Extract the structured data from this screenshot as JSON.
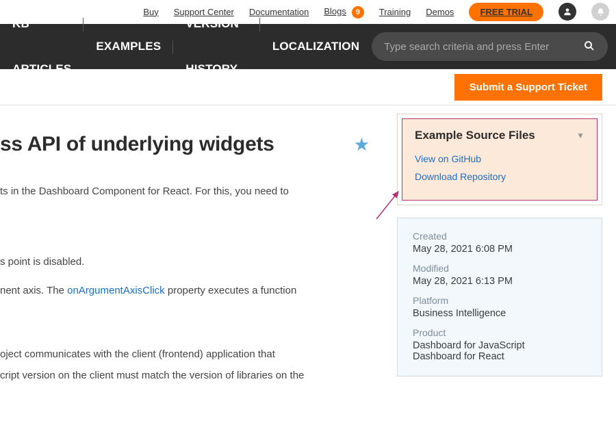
{
  "topnav": {
    "buy": "Buy",
    "support": "Support Center",
    "docs": "Documentation",
    "blogs": "Blogs",
    "blogs_count": "9",
    "training": "Training",
    "demos": "Demos",
    "free_trial": "FREE TRIAL"
  },
  "mainnav": {
    "kb": "KB ARTICLES",
    "examples": "EXAMPLES",
    "version": "VERSION HISTORY",
    "localization": "LOCALIZATION",
    "search_placeholder": "Type search criteria and press Enter"
  },
  "ticket_button": "Submit a Support Ticket",
  "article": {
    "title": "ss API of underlying widgets",
    "p1": "ts in the Dashboard Component for React. For this, you need to",
    "p2": "s point is disabled.",
    "p3_a": "nent axis. The ",
    "p3_link": "onArgumentAxisClick",
    "p3_b": " property executes a function",
    "p4": "oject communicates with the client (frontend) application that",
    "p5": "cript version on the client must match the version of libraries on the"
  },
  "sidebar": {
    "source": {
      "title": "Example Source Files",
      "github": "View on GitHub",
      "download": "Download Repository"
    },
    "meta": {
      "created_label": "Created",
      "created_value": "May 28, 2021 6:08 PM",
      "modified_label": "Modified",
      "modified_value": "May 28, 2021 6:13 PM",
      "platform_label": "Platform",
      "platform_value": "Business Intelligence",
      "product_label": "Product",
      "product_value1": "Dashboard for JavaScript",
      "product_value2": "Dashboard for React"
    }
  }
}
